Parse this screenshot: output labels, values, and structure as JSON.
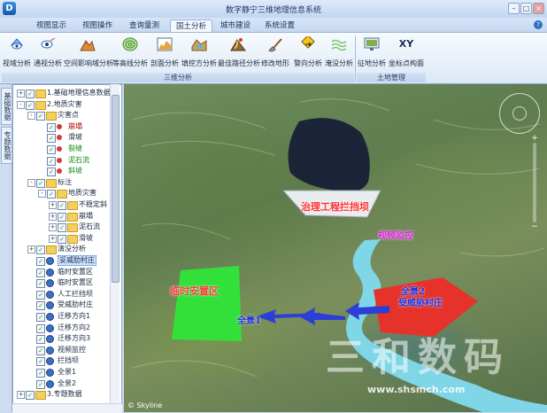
{
  "window": {
    "title": "数字静宁三维地理信息系统",
    "app_icon": "D",
    "min": "–",
    "max": "□",
    "close": "×"
  },
  "menu": {
    "tabs": [
      "视图显示",
      "视图操作",
      "查询量测",
      "国土分析",
      "城市建设",
      "系统设置"
    ],
    "active": "国土分析",
    "help_icon": "?"
  },
  "ribbon": {
    "buttons": [
      {
        "label": "视域分析",
        "icon": "eye-sector-icon"
      },
      {
        "label": "通视分析",
        "icon": "eye-line-icon"
      },
      {
        "label": "空间影响域分析",
        "icon": "terrain-influence-icon"
      },
      {
        "label": "等高线分析",
        "icon": "contour-icon"
      },
      {
        "label": "剖面分析",
        "icon": "profile-chart-icon"
      },
      {
        "label": "填挖方分析",
        "icon": "cut-fill-icon"
      },
      {
        "label": "最佳路径分析",
        "icon": "best-path-icon"
      },
      {
        "label": "修改地形",
        "icon": "shovel-icon"
      },
      {
        "label": "警向分析",
        "icon": "warning-sign-icon"
      },
      {
        "label": "淹没分析",
        "icon": "flood-icon"
      },
      {
        "label": "征地分析",
        "icon": "land-screen-icon"
      },
      {
        "label": "坐标点构面",
        "icon": "xy-icon"
      }
    ],
    "groups": [
      "三维分析",
      "土地管理"
    ],
    "xy_text": "XY"
  },
  "side_tabs": [
    "基础数据",
    "专题数据"
  ],
  "tree": [
    {
      "label": "1.基础地理信息数据",
      "level": 0,
      "expander": "+",
      "checked": true,
      "icon": "folder"
    },
    {
      "label": "2.地质灾害",
      "level": 0,
      "expander": "-",
      "checked": true,
      "icon": "folder"
    },
    {
      "label": "灾害点",
      "level": 1,
      "expander": "-",
      "checked": true,
      "icon": "folder"
    },
    {
      "label": "崩塌",
      "level": 2,
      "checked": true,
      "icon": "red-dot",
      "color": "red"
    },
    {
      "label": "滑坡",
      "level": 2,
      "checked": true,
      "icon": "red-dot",
      "color": "normal"
    },
    {
      "label": "裂缝",
      "level": 2,
      "checked": true,
      "icon": "red-dot",
      "color": "green"
    },
    {
      "label": "泥石流",
      "level": 2,
      "checked": true,
      "icon": "red-dot",
      "color": "green"
    },
    {
      "label": "斜坡",
      "level": 2,
      "checked": true,
      "icon": "red-dot",
      "color": "green"
    },
    {
      "label": "标注",
      "level": 1,
      "expander": "-",
      "checked": true,
      "icon": "folder"
    },
    {
      "label": "地质灾害",
      "level": 2,
      "expander": "-",
      "checked": true,
      "icon": "folder"
    },
    {
      "label": "不稳定斜",
      "level": 3,
      "expander": "+",
      "checked": true,
      "icon": "folder"
    },
    {
      "label": "崩塌",
      "level": 3,
      "expander": "+",
      "checked": true,
      "icon": "folder"
    },
    {
      "label": "泥石流",
      "level": 3,
      "expander": "+",
      "checked": true,
      "icon": "folder"
    },
    {
      "label": "滑坡",
      "level": 3,
      "expander": "+",
      "checked": true,
      "icon": "folder"
    },
    {
      "label": "演没分析",
      "level": 1,
      "expander": "+",
      "checked": true,
      "icon": "folder"
    },
    {
      "label": "妥威肋村庄",
      "level": 1,
      "checked": true,
      "icon": "pin",
      "selected": true
    },
    {
      "label": "临时安置区",
      "level": 1,
      "checked": true,
      "icon": "pin"
    },
    {
      "label": "临时安置区",
      "level": 1,
      "checked": true,
      "icon": "pin"
    },
    {
      "label": "人工拦挡坝",
      "level": 1,
      "checked": true,
      "icon": "pin"
    },
    {
      "label": "受威肋村庄",
      "level": 1,
      "checked": true,
      "icon": "pin"
    },
    {
      "label": "迁移方向1",
      "level": 1,
      "checked": true,
      "icon": "pin"
    },
    {
      "label": "迁移方向2",
      "level": 1,
      "checked": true,
      "icon": "pin"
    },
    {
      "label": "迁移方向3",
      "level": 1,
      "checked": true,
      "icon": "pin"
    },
    {
      "label": "视频监控",
      "level": 1,
      "checked": true,
      "icon": "pin"
    },
    {
      "label": "拦挡坝",
      "level": 1,
      "checked": true,
      "icon": "pin"
    },
    {
      "label": "全景1",
      "level": 1,
      "checked": true,
      "icon": "pin"
    },
    {
      "label": "全景2",
      "level": 1,
      "checked": true,
      "icon": "pin"
    },
    {
      "label": "3.专题数据",
      "level": 0,
      "expander": "+",
      "checked": true,
      "icon": "folder"
    }
  ],
  "map": {
    "labels": {
      "dam": "治理工程拦挡坝",
      "video": "视频监控",
      "temp_area": "临时安置区",
      "fullview1": "全景1",
      "fullview2": "全景2",
      "village": "受威胁村庄"
    },
    "watermark": "三和数码",
    "watermark_url": "www.shsmch.com",
    "skyline": "© Skyline",
    "zoom_plus": "+",
    "zoom_minus": "−",
    "colors": {
      "flood_water": "#1c2438",
      "temp_area": "#33e03a",
      "village_zone": "#e5332c",
      "river": "#7fd6e6",
      "arrow": "#2a3fd6"
    }
  }
}
